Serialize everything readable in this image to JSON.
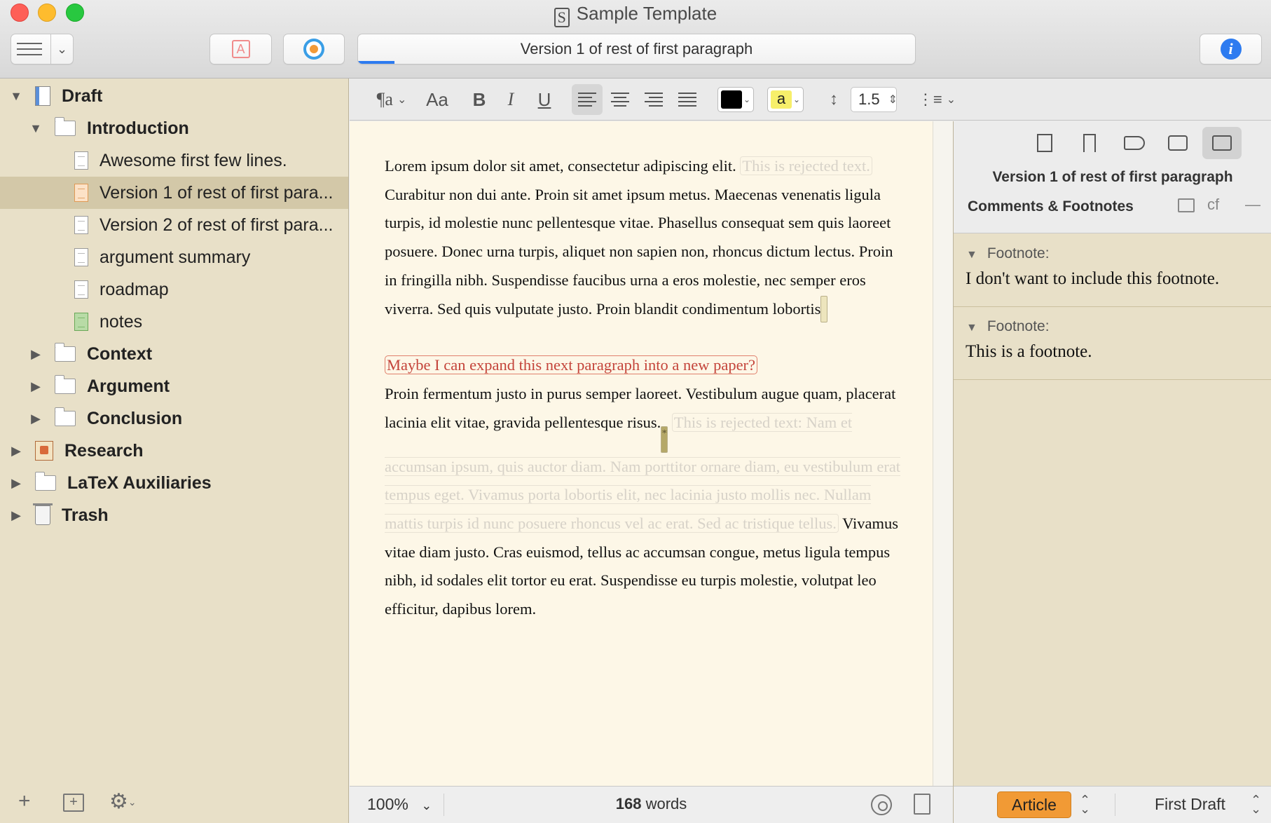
{
  "window": {
    "title": "Sample Template",
    "document_field": "Version 1 of rest of first paragraph"
  },
  "binder": {
    "items": [
      {
        "label": "Draft",
        "icon": "draft-icon",
        "indent": 0,
        "disclosure": "open",
        "bold": true,
        "selected": false
      },
      {
        "label": "Introduction",
        "icon": "folder-icon",
        "indent": 1,
        "disclosure": "open",
        "bold": true,
        "selected": false
      },
      {
        "label": "Awesome first few lines.",
        "icon": "document-icon",
        "indent": 2,
        "disclosure": "none",
        "bold": false,
        "selected": false
      },
      {
        "label": "Version 1 of rest of first para...",
        "icon": "document-orange-icon",
        "indent": 2,
        "disclosure": "none",
        "bold": false,
        "selected": true
      },
      {
        "label": "Version 2 of rest of first para...",
        "icon": "document-icon",
        "indent": 2,
        "disclosure": "none",
        "bold": false,
        "selected": false
      },
      {
        "label": "argument summary",
        "icon": "document-icon",
        "indent": 2,
        "disclosure": "none",
        "bold": false,
        "selected": false
      },
      {
        "label": "roadmap",
        "icon": "document-icon",
        "indent": 2,
        "disclosure": "none",
        "bold": false,
        "selected": false
      },
      {
        "label": "notes",
        "icon": "document-green-icon",
        "indent": 2,
        "disclosure": "none",
        "bold": false,
        "selected": false
      },
      {
        "label": "Context",
        "icon": "folder-icon",
        "indent": 1,
        "disclosure": "closed",
        "bold": true,
        "selected": false
      },
      {
        "label": "Argument",
        "icon": "folder-icon",
        "indent": 1,
        "disclosure": "closed",
        "bold": true,
        "selected": false
      },
      {
        "label": "Conclusion",
        "icon": "folder-icon",
        "indent": 1,
        "disclosure": "closed",
        "bold": true,
        "selected": false
      },
      {
        "label": "Research",
        "icon": "research-icon",
        "indent": 0,
        "disclosure": "closed",
        "bold": true,
        "selected": false
      },
      {
        "label": "LaTeX Auxiliaries",
        "icon": "folder-icon",
        "indent": 0,
        "disclosure": "closed",
        "bold": true,
        "selected": false
      },
      {
        "label": "Trash",
        "icon": "trash-icon",
        "indent": 0,
        "disclosure": "closed",
        "bold": true,
        "selected": false
      }
    ]
  },
  "formatbar": {
    "style_glyph": "¶a",
    "font_glyph": "Aa",
    "bold": "B",
    "italic": "I",
    "underline": "U",
    "text_color": "#000000",
    "highlight_color": "#f7ef6a",
    "highlight_letter": "a",
    "line_spacing": "1.5"
  },
  "editor": {
    "p1_text": "Lorem ipsum dolor sit amet, consectetur adipiscing elit.",
    "p1_rejected": "This is rejected text.",
    "p1_text2": "Curabitur non dui ante. Proin sit amet ipsum metus. Maecenas venenatis ligula turpis, id molestie nunc pellentesque vitae. Phasellus consequat sem quis laoreet posuere. Donec urna turpis, aliquet non sapien non, rhoncus dictum lectus. Proin in fringilla nibh. Suspendisse faucibus urna a eros molestie, nec semper eros viverra. Sed quis vulputate justo. Proin blandit condimentum lobortis",
    "inline_note": "Maybe I can expand this next paragraph into a new paper?",
    "p2_text": "Proin fermentum justo in purus semper laoreet. Vestibulum augue quam, placerat lacinia elit vitae, gravida pellentesque risus.",
    "p2_anchor": "*",
    "p2_rejected": "This is rejected text: Nam et accumsan ipsum, quis auctor diam. Nam porttitor ornare diam, eu vestibulum erat tempus eget. Vivamus porta lobortis elit, nec lacinia justo mollis nec. Nullam mattis turpis id nunc posuere rhoncus vel ac erat. Sed ac tristique tellus.",
    "p2_text2": "Vivamus vitae diam justo. Cras euismod, tellus ac accumsan congue, metus ligula tempus nibh, id sodales elit tortor eu erat. Suspendisse eu turpis molestie, volutpat leo efficitur, dapibus lorem."
  },
  "statusbar": {
    "zoom": "100%",
    "word_count": "168",
    "word_label": "words"
  },
  "inspector": {
    "title": "Version 1 of rest of first paragraph",
    "section": "Comments & Footnotes",
    "cf_label": "cf",
    "footnotes": [
      {
        "label": "Footnote:",
        "text": "I don't want to include this footnote."
      },
      {
        "label": "Footnote:",
        "text": "This is a footnote."
      }
    ],
    "label_value": "Article",
    "label_color": "#f19a35",
    "status_value": "First Draft"
  }
}
